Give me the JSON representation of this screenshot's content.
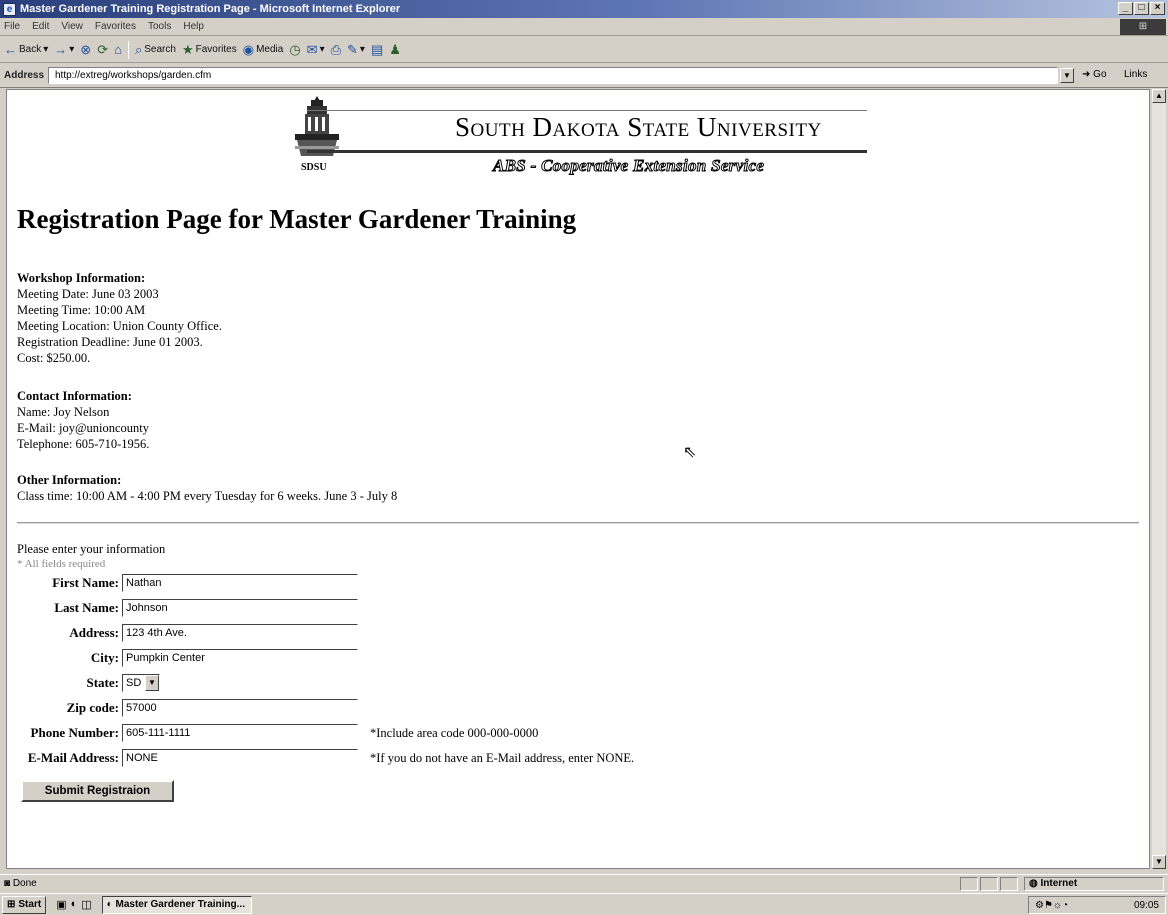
{
  "window": {
    "title": "Master Gardener Training Registration Page - Microsoft Internet Explorer",
    "controls": [
      "_",
      "□",
      "×"
    ]
  },
  "menu": [
    "File",
    "Edit",
    "View",
    "Favorites",
    "Tools",
    "Help"
  ],
  "toolbar": {
    "back": "Back",
    "search": "Search",
    "favorites": "Favorites",
    "media": "Media"
  },
  "address": {
    "label": "Address",
    "url": "http://extreg/workshops/garden.cfm",
    "go": "Go",
    "links": "Links"
  },
  "banner": {
    "university": "South Dakota State University",
    "extension": "ABS - Cooperative Extension Service",
    "seal_label": "SDSU"
  },
  "page": {
    "title": "Registration Page for Master Gardener Training",
    "workshop": {
      "heading": "Workshop Information:",
      "lines": [
        "Meeting Date: June 03 2003",
        "Meeting Time: 10:00 AM",
        "Meeting Location: Union County Office.",
        "Registration Deadline: June 01 2003.",
        "Cost: $250.00."
      ]
    },
    "contact": {
      "heading": "Contact Information:",
      "lines": [
        "Name: Joy Nelson",
        "E-Mail: joy@unioncounty",
        "Telephone: 605-710-1956."
      ]
    },
    "other": {
      "heading": "Other Information:",
      "lines": [
        "Class time: 10:00 AM - 4:00 PM every Tuesday for 6 weeks. June 3 - July 8"
      ]
    }
  },
  "form": {
    "prompt": "Please enter your information",
    "required_note": "* All fields required",
    "fields": {
      "first_name": {
        "label": "First Name:",
        "value": "Nathan"
      },
      "last_name": {
        "label": "Last Name:",
        "value": "Johnson"
      },
      "address": {
        "label": "Address:",
        "value": "123 4th Ave."
      },
      "city": {
        "label": "City:",
        "value": "Pumpkin Center"
      },
      "state": {
        "label": "State:",
        "value": "SD"
      },
      "zip": {
        "label": "Zip code:",
        "value": "57000"
      },
      "phone": {
        "label": "Phone Number:",
        "value": "605-111-1111",
        "note": "*Include area code 000-000-0000"
      },
      "email": {
        "label": "E-Mail Address:",
        "value": "NONE",
        "note": "*If you do not have an E-Mail address, enter NONE."
      }
    },
    "submit_label": "Submit Registraion"
  },
  "status": {
    "text": "Done",
    "zone": "Internet"
  },
  "taskbar": {
    "start": "Start",
    "task": "Master Gardener Training...",
    "clock": "09:05"
  }
}
